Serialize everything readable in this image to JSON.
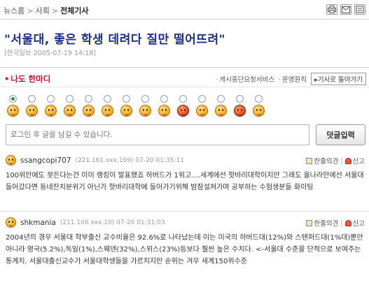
{
  "breadcrumb": {
    "home": "뉴스홈",
    "sep": ">",
    "section": "사회",
    "current": "전체기사"
  },
  "tools": [
    "print-icon",
    "email-icon",
    "scrap-icon"
  ],
  "article": {
    "headline": "\"서울대, 좋은 학생 데려다 질만 떨어뜨려\"",
    "dateline": "[한국일보 2005-07-19 14:18]"
  },
  "comments_header": {
    "title": "나도 한마디",
    "links": [
      "게시중단요청서비스",
      "운영원칙"
    ],
    "back_label": "기사로 돌아가기"
  },
  "moods": {
    "count": 14,
    "selected_index": 0
  },
  "input": {
    "placeholder": "로그인 후 글을 남길 수 있습니다."
  },
  "submit_label": "덧글입력",
  "comments": [
    {
      "user": "ssangcopi707",
      "meta": "(221.161.xxx.169) 07-20 01:35:11",
      "opinion_label": "한줄의견",
      "report_label": "신고",
      "body": "100위안에도 못든다는건 이미 랭킹이 발표됐죠 하버드가 1위고....세계에선 핫바리대학이지만 그래도 올나라안에선 서울대 들어갔다면 동네잔치분위기 아닌가 핫바리대학에 들어가기위해 밤잠설쳐가며 공부하는 수험생분들 화이팅"
    },
    {
      "user": "shkmania",
      "meta": "(211.106.xxx.10) 07-20 01:31:03",
      "opinion_label": "한줄의견",
      "report_label": "신고",
      "body": "2004년의 경우 서울대 학부출신 교수비율은 92.6%로 나타났는데 이는 미국의 하버드대(12%)와 스탠퍼드대(1%대)뿐만 아니라 영국(5.2%),독일(1%),스웨덴(32%),스위스(23%)등보다 훨씬 높은 수치다. <-서울대 수준을 단적으로 보여주는 통계치. 서울대출신교수가 서울대학생들을 가르치지만 순위는 겨우 세계150위수준"
    }
  ]
}
